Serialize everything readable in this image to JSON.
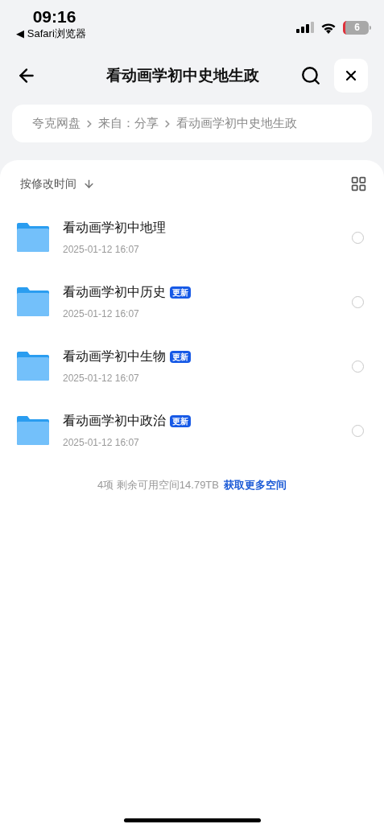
{
  "status_bar": {
    "time": "09:16",
    "back_app": "◀ Safari浏览器",
    "battery": "6"
  },
  "header": {
    "title": "看动画学初中史地生政"
  },
  "breadcrumb": [
    "夸克网盘",
    "来自：分享",
    "看动画学初中史地生政"
  ],
  "sort": {
    "label": "按修改时间"
  },
  "files": [
    {
      "name": "看动画学初中地理",
      "date": "2025-01-12 16:07",
      "selected": false
    },
    {
      "name": "看动画学初中历史",
      "badge": "更新",
      "date": "2025-01-12 16:07",
      "selected": false
    },
    {
      "name": "看动画学初中生物",
      "badge": "更新",
      "date": "2025-01-12 16:07",
      "selected": false
    },
    {
      "name": "看动画学初中政治",
      "badge": "更新",
      "date": "2025-01-12 16:07",
      "selected": false
    }
  ],
  "footer": {
    "summary": "4项 剩余可用空间14.79TB",
    "link": "获取更多空间"
  }
}
